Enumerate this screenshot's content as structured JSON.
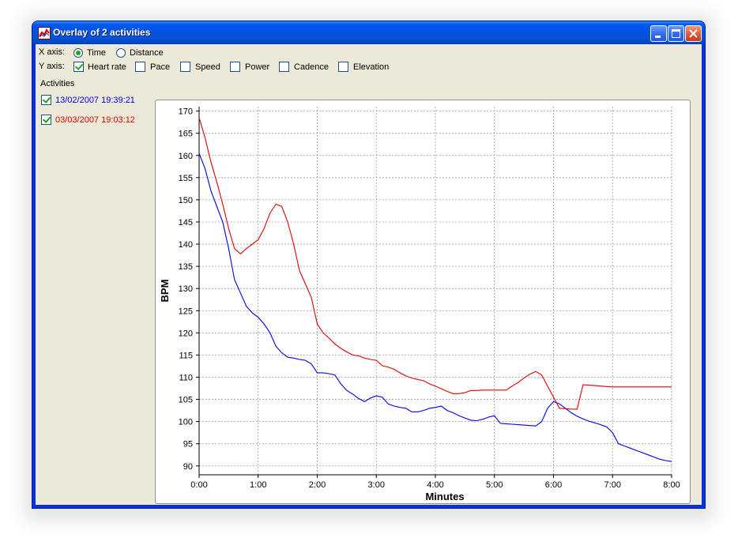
{
  "window": {
    "title": "Overlay of 2 activities",
    "controls": [
      "minimize",
      "maximize",
      "close"
    ]
  },
  "options": {
    "x_axis": {
      "label": "X axis:",
      "choices": [
        {
          "label": "Time",
          "selected": true
        },
        {
          "label": "Distance",
          "selected": false
        }
      ]
    },
    "y_axis": {
      "label": "Y axis:",
      "choices": [
        {
          "label": "Heart rate",
          "checked": true
        },
        {
          "label": "Pace",
          "checked": false
        },
        {
          "label": "Speed",
          "checked": false
        },
        {
          "label": "Power",
          "checked": false
        },
        {
          "label": "Cadence",
          "checked": false
        },
        {
          "label": "Elevation",
          "checked": false
        }
      ]
    }
  },
  "activities": {
    "heading": "Activities",
    "items": [
      {
        "label": "13/02/2007 19:39:21",
        "checked": true,
        "color": "#0000ee"
      },
      {
        "label": "03/03/2007 19:03:12",
        "checked": true,
        "color": "#dd0000"
      }
    ]
  },
  "chart_data": {
    "type": "line",
    "title": "",
    "xlabel": "Minutes",
    "ylabel": "BPM",
    "xlim": [
      0,
      480
    ],
    "ylim": [
      88,
      171
    ],
    "x_ticks": [
      0,
      60,
      120,
      180,
      240,
      300,
      360,
      420,
      480
    ],
    "x_tick_labels": [
      "0:00",
      "1:00",
      "2:00",
      "3:00",
      "4:00",
      "5:00",
      "6:00",
      "7:00",
      "8:00"
    ],
    "y_ticks": [
      90,
      95,
      100,
      105,
      110,
      115,
      120,
      125,
      130,
      135,
      140,
      145,
      150,
      155,
      160,
      165,
      170
    ],
    "grid": true,
    "series": [
      {
        "name": "13/02/2007 19:39:21",
        "color": "#0000ee",
        "x": [
          0,
          6,
          12,
          18,
          24,
          30,
          36,
          42,
          48,
          54,
          60,
          66,
          72,
          78,
          84,
          90,
          96,
          102,
          108,
          114,
          120,
          126,
          132,
          138,
          144,
          150,
          156,
          162,
          168,
          174,
          180,
          186,
          192,
          198,
          204,
          210,
          216,
          222,
          228,
          234,
          240,
          246,
          252,
          258,
          264,
          270,
          276,
          282,
          288,
          294,
          300,
          306,
          312,
          318,
          324,
          330,
          336,
          342,
          348,
          354,
          360,
          366,
          372,
          378,
          384,
          390,
          396,
          402,
          408,
          414,
          420,
          426,
          432,
          438,
          444,
          450,
          456,
          462,
          468,
          474,
          480
        ],
        "values": [
          160.5,
          157,
          152,
          148.5,
          145,
          139,
          132,
          129,
          126,
          124.5,
          123.5,
          122,
          120,
          117,
          115.5,
          114.5,
          114.3,
          114,
          113.8,
          113,
          111,
          111,
          110.8,
          110.5,
          108.5,
          107,
          106.2,
          105.2,
          104.5,
          105.3,
          105.8,
          105.5,
          104,
          103.5,
          103.2,
          103,
          102.2,
          102.2,
          102.5,
          103,
          103.2,
          103.5,
          102.5,
          102,
          101.3,
          100.8,
          100.3,
          100.2,
          100.5,
          101,
          101.3,
          99.6,
          99.5,
          99.4,
          99.3,
          99.2,
          99.1,
          99,
          100,
          103,
          104.5,
          104,
          103,
          102,
          101.2,
          100.6,
          100.1,
          99.7,
          99.3,
          98.8,
          97.5,
          95,
          94.5,
          94,
          93.5,
          93,
          92.5,
          92,
          91.5,
          91.2,
          91
        ]
      },
      {
        "name": "03/03/2007 19:03:12",
        "color": "#dd0000",
        "x": [
          0,
          6,
          12,
          18,
          24,
          30,
          36,
          42,
          48,
          54,
          60,
          66,
          72,
          78,
          84,
          90,
          96,
          102,
          108,
          114,
          120,
          126,
          132,
          138,
          144,
          150,
          156,
          162,
          168,
          174,
          180,
          186,
          192,
          198,
          204,
          210,
          216,
          222,
          228,
          234,
          240,
          246,
          252,
          258,
          264,
          270,
          276,
          282,
          288,
          294,
          300,
          306,
          312,
          318,
          324,
          330,
          336,
          342,
          348,
          354,
          360,
          366,
          372,
          378,
          384,
          390,
          396,
          402,
          408,
          414,
          420,
          426,
          432,
          438,
          444,
          450,
          456,
          462,
          468,
          474,
          480
        ],
        "values": [
          168.5,
          164,
          158.5,
          154,
          149,
          143.5,
          139,
          137.8,
          139,
          140,
          141,
          143.5,
          147,
          149,
          148.5,
          145,
          140,
          134,
          131,
          128,
          122,
          120,
          118.8,
          117.5,
          116.5,
          115.7,
          115,
          114.8,
          114.3,
          114,
          113.8,
          112.6,
          112.3,
          111.8,
          111,
          110.3,
          109.8,
          109.5,
          109.2,
          108.5,
          108,
          107.4,
          106.8,
          106.3,
          106.3,
          106.5,
          107,
          107,
          107.1,
          107.1,
          107.1,
          107.1,
          107.1,
          108,
          108.8,
          109.8,
          110.7,
          111.3,
          110.5,
          108,
          105.5,
          103,
          102.9,
          102.8,
          102.8,
          108.3,
          108.2,
          108.1,
          108,
          107.9,
          107.8,
          107.8,
          107.8,
          107.8,
          107.8,
          107.8,
          107.8,
          107.8,
          107.8,
          107.8,
          107.8
        ]
      }
    ]
  }
}
